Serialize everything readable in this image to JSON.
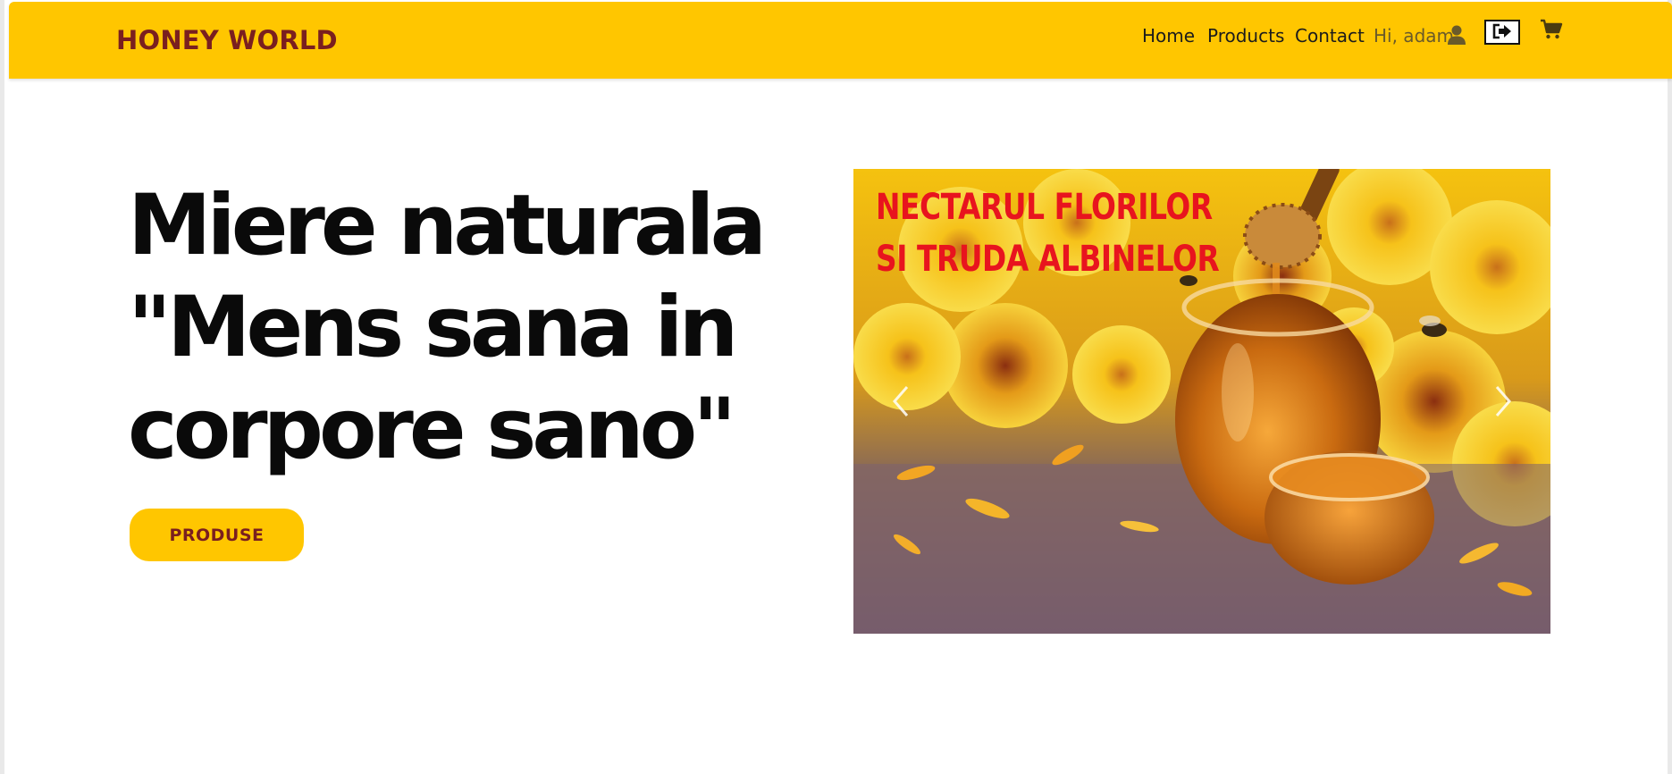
{
  "navbar": {
    "brand": "HONEY WORLD",
    "links": [
      "Home",
      "Products",
      "Contact"
    ],
    "greeting": "Hi, adam",
    "icons": [
      "user-icon",
      "logout-icon",
      "cart-icon"
    ]
  },
  "hero": {
    "title_lines": [
      "Miere naturala",
      "\"Mens sana in",
      "corpore sano\""
    ],
    "cta_label": "PRODUSE"
  },
  "carousel": {
    "slide_caption_lines": [
      "NECTARUL FLORILOR",
      "SI TRUDA ALBINELOR"
    ],
    "controls": [
      "chevron-left-icon",
      "chevron-right-icon"
    ]
  },
  "colors": {
    "accent": "#ffc600",
    "brand_text": "#7a1f1f",
    "caption_red": "#e8141e"
  }
}
